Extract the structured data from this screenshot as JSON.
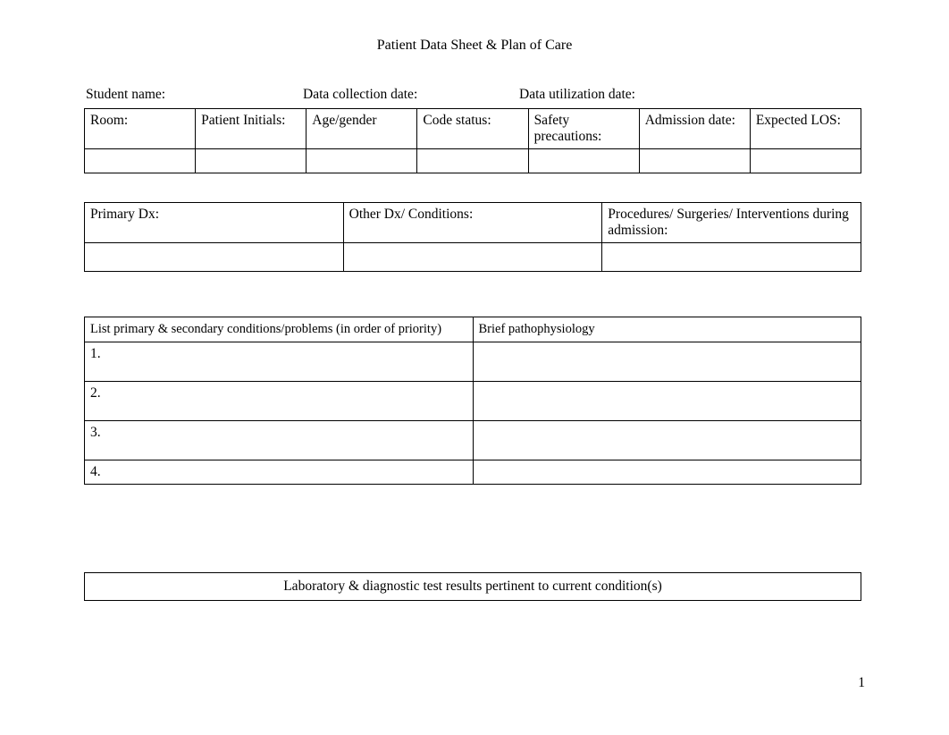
{
  "title": "Patient Data Sheet & Plan of Care",
  "header": {
    "student_name": "Student name:",
    "collection_date": "Data collection date:",
    "utilization_date": "Data utilization date:"
  },
  "table1": {
    "room": "Room:",
    "initials": "Patient Initials:",
    "age_gender": "Age/gender",
    "code_status": "Code status:",
    "safety": "Safety precautions:",
    "admission": "Admission date:",
    "expected_los": "Expected LOS:"
  },
  "table2": {
    "primary_dx": "Primary Dx:",
    "other_dx": "Other Dx/ Conditions:",
    "procedures": "Procedures/ Surgeries/ Interventions during admission:"
  },
  "table3": {
    "header_left": "List primary & secondary conditions/problems  (in order of priority)",
    "header_right": "Brief pathophysiology",
    "rows": [
      "1.",
      "2.",
      "3.",
      "4."
    ]
  },
  "table4": {
    "header": "Laboratory & diagnostic test results pertinent to current condition(s)"
  },
  "page_number": "1"
}
